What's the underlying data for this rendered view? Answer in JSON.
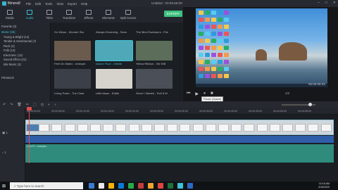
{
  "app": {
    "logo": "filmora9",
    "window_title": "Untitled : 00:05:55:09"
  },
  "menu": [
    "File",
    "Edit",
    "Tools",
    "View",
    "Export",
    "Help"
  ],
  "tabs": [
    {
      "label": "Media"
    },
    {
      "label": "Audio",
      "active": true
    },
    {
      "label": "Titles"
    },
    {
      "label": "Transition"
    },
    {
      "label": "Effects"
    },
    {
      "label": "Elements"
    },
    {
      "label": "Split Screen"
    }
  ],
  "export_label": "EXPORT",
  "library": {
    "favorites": "Favorite (0)",
    "items": [
      {
        "label": "Music (26)",
        "selected": true
      },
      {
        "label": "Young & Bright (14)"
      },
      {
        "label": "Tender & Sentimental (7)"
      },
      {
        "label": "Rock (4)"
      },
      {
        "label": "Folk (13)"
      },
      {
        "label": "Electronic (13)"
      },
      {
        "label": "Sound Effect (21)"
      },
      {
        "label": "Mix Music (3)"
      }
    ],
    "filmstock": "Filmstock"
  },
  "media_grid": [
    {
      "caption": "Go Minus - Wonder Sta",
      "color": "#2d3138"
    },
    {
      "caption": "Always Dreaming - Sano",
      "color": "#2d3138"
    },
    {
      "caption": "The Mind Sweepers - Fire",
      "color": "#2d3138"
    },
    {
      "caption": "Feet On Water - Unesyst",
      "color": "#6b5b4e"
    },
    {
      "caption": "Dance Floor - Infinite",
      "color": "#4fa8b8",
      "selected": true
    },
    {
      "caption": "Yellow Ribbon - We Will",
      "color": "#5c6e5a"
    },
    {
      "caption": "Living Pulse - The Chas",
      "color": "#3a3f48"
    },
    {
      "caption": "Little Maze - Eddie",
      "color": "#d6d2cc"
    },
    {
      "caption": "Since I Started - Roll It W",
      "color": "#4a4f58"
    }
  ],
  "preview": {
    "timecode": "00:00:00:24",
    "ratio": "1/2",
    "tooltip": "Pause (Space)"
  },
  "toolbar_icons": [
    "undo-icon",
    "redo-icon",
    "delete-icon",
    "cut-icon",
    "crop-icon",
    "speed-icon",
    "color-icon",
    "audio-icon"
  ],
  "ruler": [
    "00:00:00:00",
    "00:00:05:00",
    "00:00:10:00",
    "00:00:15:00",
    "00:00:20:00",
    "00:00:25:00",
    "00:00:30:00",
    "00:00:35:00",
    "00:00:40:00",
    "00:00:45:00",
    "00:00:50:00",
    "00:00:55:00"
  ],
  "tracks": {
    "video": "1",
    "audio": "1"
  },
  "audio_clip_label": "Lost Ft - Unesyst...",
  "taskbar": {
    "search_placeholder": "Type here to search",
    "time": "10:18 AM",
    "date": "3/16/2020"
  }
}
